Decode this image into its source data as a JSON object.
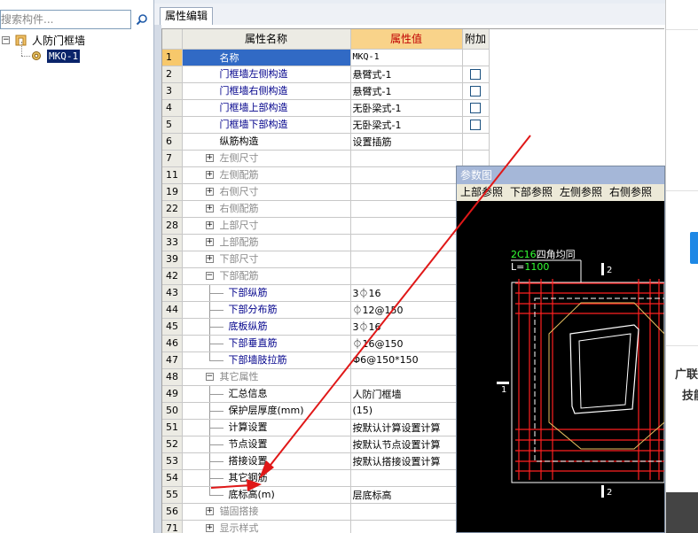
{
  "tree": {
    "search_placeholder": "搜索构件...",
    "root_label": "人防门框墙",
    "child_label": "MKQ-1"
  },
  "tab": {
    "label": "属性编辑"
  },
  "grid": {
    "headers": {
      "name": "属性名称",
      "value": "属性值",
      "extra": "附加"
    },
    "rows": [
      {
        "num": "1",
        "name": "名称",
        "value": "MKQ-1"
      },
      {
        "num": "2",
        "name": "门框墙左侧构造",
        "value": "悬臂式-1"
      },
      {
        "num": "3",
        "name": "门框墙右侧构造",
        "value": "悬臂式-1"
      },
      {
        "num": "4",
        "name": "门框墙上部构造",
        "value": "无卧梁式-1"
      },
      {
        "num": "5",
        "name": "门框墙下部构造",
        "value": "无卧梁式-1"
      },
      {
        "num": "6",
        "name": "纵筋构造",
        "value": "设置插筋"
      },
      {
        "num": "7",
        "name": "左侧尺寸",
        "value": ""
      },
      {
        "num": "11",
        "name": "左侧配筋",
        "value": ""
      },
      {
        "num": "19",
        "name": "右侧尺寸",
        "value": ""
      },
      {
        "num": "22",
        "name": "右侧配筋",
        "value": ""
      },
      {
        "num": "28",
        "name": "上部尺寸",
        "value": ""
      },
      {
        "num": "33",
        "name": "上部配筋",
        "value": ""
      },
      {
        "num": "39",
        "name": "下部尺寸",
        "value": ""
      },
      {
        "num": "42",
        "name": "下部配筋",
        "value": ""
      },
      {
        "num": "43",
        "name": "下部纵筋",
        "value": "3⏀16"
      },
      {
        "num": "44",
        "name": "下部分布筋",
        "value": "⏀12@150"
      },
      {
        "num": "45",
        "name": "底板纵筋",
        "value": "3⏀16"
      },
      {
        "num": "46",
        "name": "下部垂直筋",
        "value": "⏀16@150"
      },
      {
        "num": "47",
        "name": "下部墙肢拉筋",
        "value": "Φ6@150*150"
      },
      {
        "num": "48",
        "name": "其它属性",
        "value": ""
      },
      {
        "num": "49",
        "name": "汇总信息",
        "value": "人防门框墙"
      },
      {
        "num": "50",
        "name": "保护层厚度(mm)",
        "value": "(15)"
      },
      {
        "num": "51",
        "name": "计算设置",
        "value": "按默认计算设置计算"
      },
      {
        "num": "52",
        "name": "节点设置",
        "value": "按默认节点设置计算"
      },
      {
        "num": "53",
        "name": "搭接设置",
        "value": "按默认搭接设置计算"
      },
      {
        "num": "54",
        "name": "其它钢筋",
        "value": ""
      },
      {
        "num": "55",
        "name": "底标高(m)",
        "value": "层底标高"
      },
      {
        "num": "56",
        "name": "锚固搭接",
        "value": ""
      },
      {
        "num": "71",
        "name": "显示样式",
        "value": ""
      }
    ],
    "expand_plus": "+",
    "expand_minus": "−"
  },
  "figure": {
    "title": "参数图",
    "tabs": [
      "上部参照",
      "下部参照",
      "左侧参照",
      "右侧参照"
    ],
    "label_bar": "2C16",
    "label_text": "四角均同",
    "label_L": "L=",
    "label_L_value": "1100",
    "mark_top": "2",
    "mark_bottom": "2",
    "mark_left": "1"
  },
  "far_right": {
    "text1": "广联",
    "text2": "技能"
  },
  "colors": {
    "selection": "#316ac5",
    "header_value": "#f9d38a",
    "rebar": "#ff2020",
    "annotation_arrow": "#e01818"
  }
}
